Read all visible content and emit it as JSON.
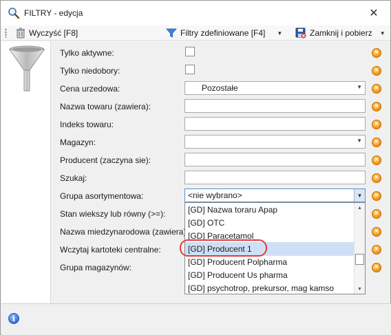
{
  "window": {
    "title": "FILTRY - edycja",
    "close_glyph": "✕"
  },
  "toolbar": {
    "clear_label": "Wyczyść [F8]",
    "predefined_label": "Filtry zdefiniowane [F4]",
    "close_fetch_label": "Zamknij i pobierz"
  },
  "form": {
    "rows": [
      {
        "label": "Tylko aktywne:",
        "type": "checkbox"
      },
      {
        "label": "Tylko niedobory:",
        "type": "checkbox"
      },
      {
        "label": "Cena urzedowa:",
        "type": "combo",
        "value": "Pozostałe"
      },
      {
        "label": "Nazwa towaru (zawiera):",
        "type": "text",
        "value": ""
      },
      {
        "label": "Indeks towaru:",
        "type": "text",
        "value": ""
      },
      {
        "label": "Magazyn:",
        "type": "combo",
        "value": ""
      },
      {
        "label": "Producent (zaczyna sie):",
        "type": "text",
        "value": ""
      },
      {
        "label": "Szukaj:",
        "type": "text",
        "value": ""
      },
      {
        "label": "Grupa asortymentowa:",
        "type": "combo",
        "value": "<nie wybrano>"
      },
      {
        "label": "Stan wiekszy lub równy (>=):"
      },
      {
        "label": "Nazwa miedzynarodowa (zawiera):"
      },
      {
        "label": "Wczytaj kartoteki centralne:"
      },
      {
        "label": "Grupa magazynów:"
      }
    ],
    "clear_glyph": "×"
  },
  "dropdown": {
    "items": [
      "[GD] Nazwa toraru Apap",
      "[GD] OTC",
      "[GD] Paracetamol",
      "[GD] Producent 1",
      "[GD] Producent Polpharma",
      "[GD] Producent Us pharma",
      "[GD] psychotrop, prekursor, mag kamso"
    ],
    "selected_index": 3
  },
  "status": {
    "info_glyph": "i"
  },
  "colors": {
    "selection": "#cfe0f5",
    "highlight_ring": "#e03a3a",
    "clear_icon": "#f29a1c"
  }
}
